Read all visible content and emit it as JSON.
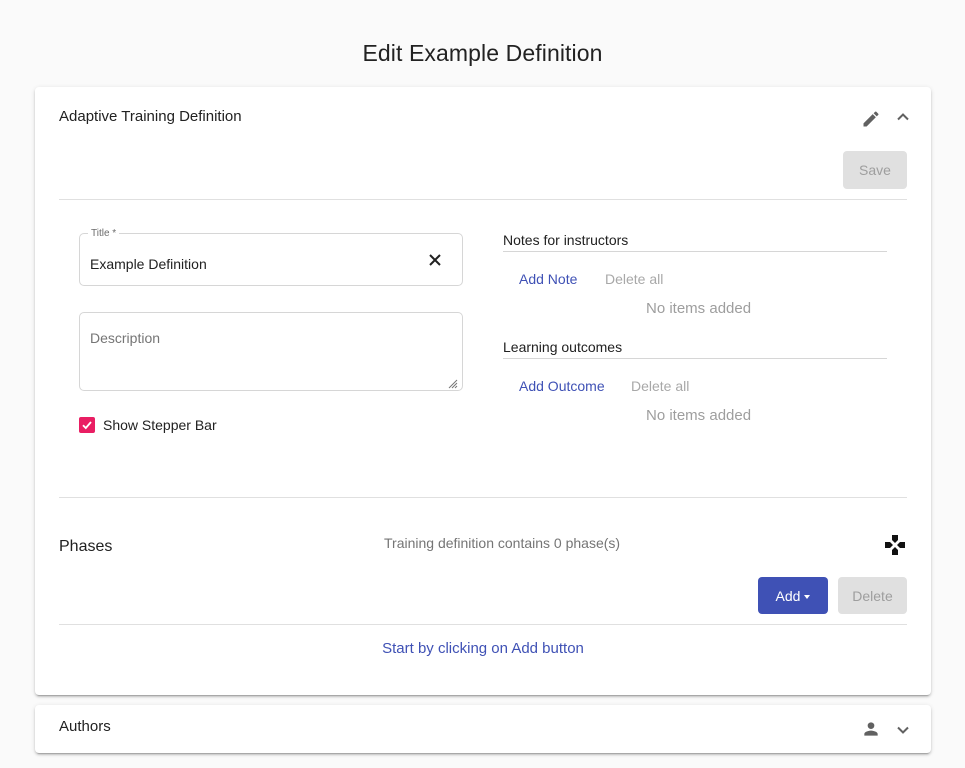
{
  "page": {
    "title": "Edit Example Definition"
  },
  "definition_panel": {
    "title": "Adaptive Training Definition",
    "save_label": "Save",
    "title_field": {
      "label": "Title *",
      "value": "Example Definition"
    },
    "description_field": {
      "placeholder": "Description",
      "value": ""
    },
    "show_stepper": {
      "label": "Show Stepper Bar",
      "checked": true
    },
    "notes": {
      "heading": "Notes for instructors",
      "add_label": "Add Note",
      "delete_label": "Delete all",
      "empty_text": "No items added"
    },
    "outcomes": {
      "heading": "Learning outcomes",
      "add_label": "Add Outcome",
      "delete_label": "Delete all",
      "empty_text": "No items added"
    }
  },
  "phases": {
    "title": "Phases",
    "count_text": "Training definition contains 0 phase(s)",
    "add_label": "Add",
    "delete_label": "Delete",
    "empty_hint": "Start by clicking on Add button"
  },
  "authors_panel": {
    "title": "Authors"
  },
  "icons": {
    "edit": "pencil-icon",
    "collapse": "chevron-up-icon",
    "expand": "chevron-down-icon",
    "clear": "close-icon",
    "phases": "gamepad-icon",
    "authors": "person-icon"
  },
  "colors": {
    "primary": "#3f51b5",
    "accent": "#e91e63",
    "disabled_bg": "#e0e0e0",
    "disabled_text": "#9e9e9e"
  }
}
